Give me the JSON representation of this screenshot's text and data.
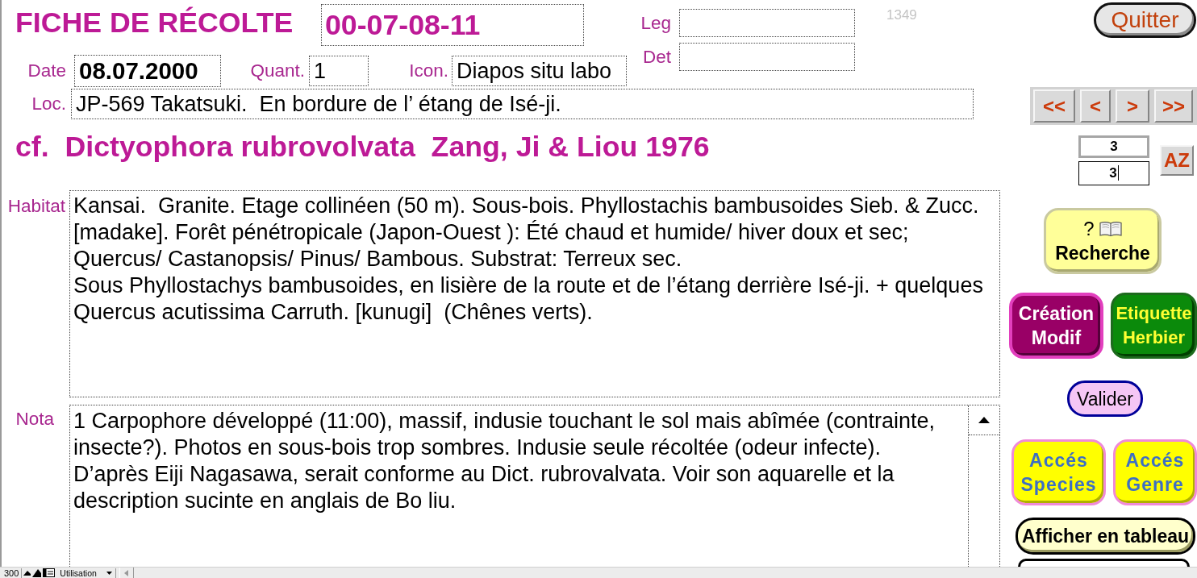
{
  "header": {
    "title": "FICHE DE RÉCOLTE",
    "record_id": "00-07-08-11",
    "record_count": "1349"
  },
  "people": [
    {
      "label": "Leg"
    },
    {
      "label": "Det"
    }
  ],
  "details": [
    {
      "label": "Date",
      "value": "08.07.2000",
      "kind": "date"
    },
    {
      "label": "Quant.",
      "value": "1",
      "kind": "quantity"
    },
    {
      "label": "Icon.",
      "value": "Diapos situ labo",
      "kind": "text"
    }
  ],
  "location": {
    "label": "Loc.",
    "value": "JP-569 Takatsuki.  En bordure de l’ étang de Isé-ji."
  },
  "taxon": "cf.  Dictyophora rubrovolvata  Zang, Ji & Liou 1976",
  "habitat": {
    "label": "Habitat",
    "lines": [
      "Kansai.  Granite. Etage collinéen (50 m). Sous-bois. Phyllostachis bambusoides Sieb. & Zucc.",
      "[madake]. Forêt pénétropicale (Japon-Ouest ): Été chaud et humide/ hiver doux et sec;",
      "Quercus/ Castanopsis/ Pinus/ Bambous. Substrat: Terreux sec.",
      "Sous Phyllostachys bambusoides, en lisière de la route et de l’étang derrière Isé-ji. + quelques",
      "Quercus acutissima Carruth. [kunugi]  (Chênes verts)."
    ]
  },
  "nota": {
    "label": "Nota",
    "lines": [
      "1 Carpophore développé (11:00), massif, indusie touchant le sol mais abîmée (contrainte,",
      "insecte?). Photos en sous-bois trop sombres. Indusie seule récoltée (odeur infecte).",
      "D’après Eiji Nagasawa, serait conforme au Dict. rubrovalvata. Voir son aquarelle et la",
      "description sucinte en anglais de Bo liu."
    ]
  },
  "quit_button": {
    "label": "Quitter"
  },
  "navigation": [
    {
      "label": "<<"
    },
    {
      "label": "<"
    },
    {
      "label": ">"
    },
    {
      "label": ">>"
    }
  ],
  "counters": [
    {
      "value": "3",
      "kind": "display",
      "focused": false
    },
    {
      "value": "3",
      "kind": "input",
      "focused": true
    }
  ],
  "sort_button": {
    "label": "AZ"
  },
  "action_rows": [
    [
      {
        "kind": "search",
        "symbol": "?",
        "label": "Recherche"
      }
    ],
    [
      {
        "kind": "create",
        "label": "Création Modif"
      },
      {
        "kind": "print",
        "label": "Etiquette Herbier"
      }
    ],
    [
      {
        "kind": "validate",
        "label": "Valider"
      }
    ],
    [
      {
        "kind": "access",
        "label": "Accés Species"
      },
      {
        "kind": "access",
        "label": "Accés Genre"
      }
    ],
    [
      {
        "kind": "table",
        "label": "Afficher en tableau"
      }
    ],
    [
      {
        "kind": "cut_off"
      }
    ]
  ],
  "status_bar": {
    "zoom": "300",
    "mode": "Utilisation"
  }
}
